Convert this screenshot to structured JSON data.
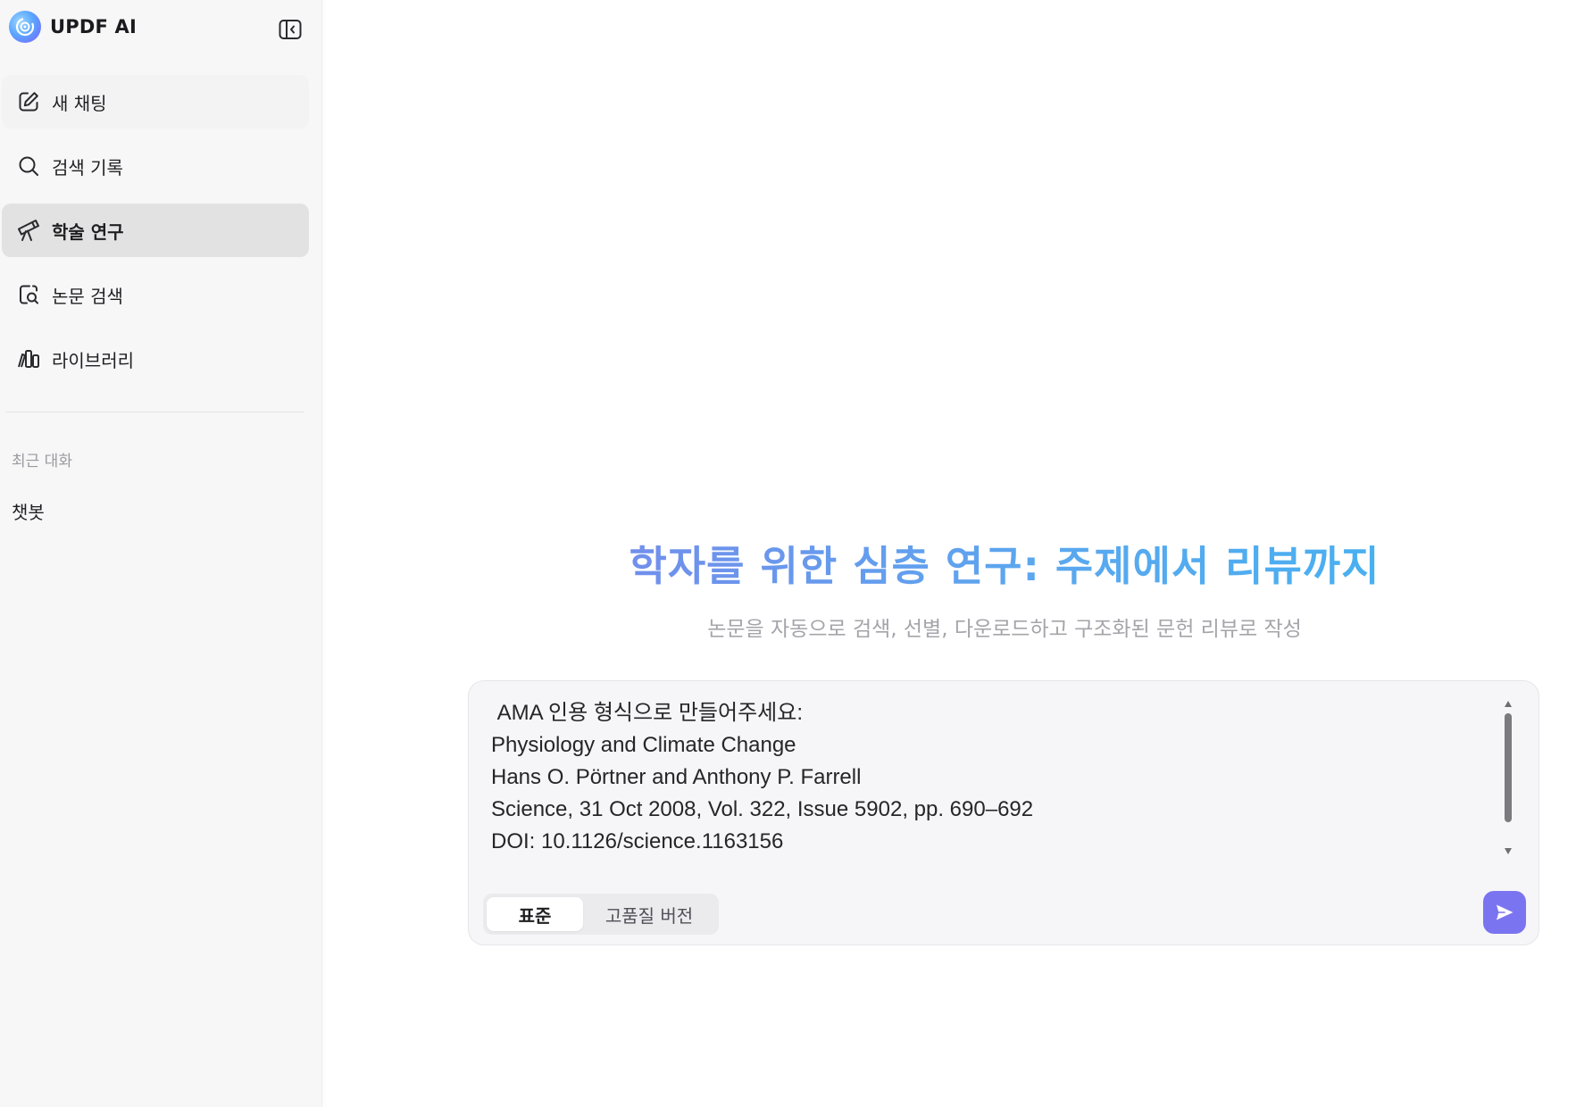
{
  "app": {
    "name": "UPDF AI"
  },
  "sidebar": {
    "items": [
      {
        "label": "새 채팅",
        "icon": "edit-icon"
      },
      {
        "label": "검색 기록",
        "icon": "search-icon"
      },
      {
        "label": "학술 연구",
        "icon": "telescope-icon",
        "active": true
      },
      {
        "label": "논문 검색",
        "icon": "document-search-icon"
      },
      {
        "label": "라이브러리",
        "icon": "library-icon"
      }
    ],
    "recent_title": "최근 대화",
    "recent_items": [
      {
        "label": "챗봇"
      }
    ]
  },
  "main": {
    "headline": "학자를 위한 심층 연구: 주제에서 리뷰까지",
    "subhead": "논문을 자동으로 검색, 선별, 다운로드하고 구조화된 문헌 리뷰로 작성",
    "prompt_text": " AMA 인용 형식으로 만들어주세요:\nPhysiology and Climate Change\nHans O. Pörtner and Anthony P. Farrell\nScience, 31 Oct 2008, Vol. 322, Issue 5902, pp. 690–692\nDOI: 10.1126/science.1163156",
    "modes": [
      {
        "label": "표준",
        "selected": true
      },
      {
        "label": "고품질 버전",
        "selected": false
      }
    ]
  },
  "colors": {
    "accent": "#7b74f1",
    "active_nav": "#e2e2e3",
    "sidebar_bg": "#f7f7f8",
    "headline_start": "#7b84ea",
    "headline_end": "#3fb4f0"
  }
}
